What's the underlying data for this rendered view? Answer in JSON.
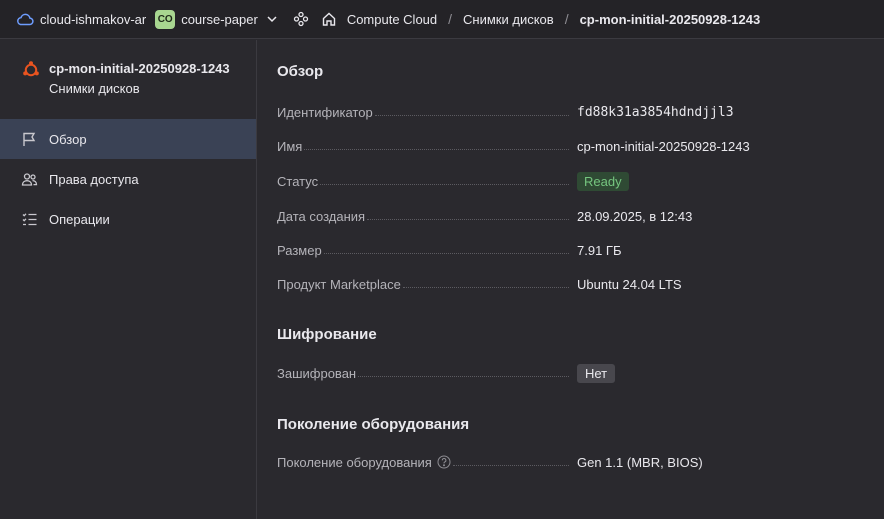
{
  "topbar": {
    "cloud_name": "cloud-ishmakov-ar",
    "folder_badge": "CO",
    "folder_name": "course-paper",
    "crumbs": [
      "Compute Cloud",
      "Снимки дисков",
      "cp-mon-initial-20250928-1243"
    ],
    "separator": "/"
  },
  "resource": {
    "title": "cp-mon-initial-20250928-1243",
    "subtitle": "Снимки дисков"
  },
  "nav": {
    "items": [
      {
        "label": "Обзор",
        "icon": "flag-icon",
        "active": true
      },
      {
        "label": "Права доступа",
        "icon": "users-icon",
        "active": false
      },
      {
        "label": "Операции",
        "icon": "list-icon",
        "active": false
      }
    ]
  },
  "overview": {
    "title": "Обзор",
    "rows": [
      {
        "label": "Идентификатор",
        "value": "fd88k31a3854hdndjjl3"
      },
      {
        "label": "Имя",
        "value": "cp-mon-initial-20250928-1243"
      },
      {
        "label": "Статус",
        "value": "Ready"
      },
      {
        "label": "Дата создания",
        "value": "28.09.2025, в 12:43"
      },
      {
        "label": "Размер",
        "value": "7.91 ГБ"
      },
      {
        "label": "Продукт Marketplace",
        "value": "Ubuntu 24.04 LTS"
      }
    ]
  },
  "encryption": {
    "title": "Шифрование",
    "rows": [
      {
        "label": "Зашифрован",
        "value": "Нет"
      }
    ]
  },
  "hardware": {
    "title": "Поколение оборудования",
    "rows": [
      {
        "label": "Поколение оборудования",
        "value": "Gen 1.1 (MBR, BIOS)"
      }
    ]
  },
  "colors": {
    "background": "#2a292e",
    "topbar": "#242327",
    "active_nav": "#3a4255",
    "status_ready": "#75c57f",
    "link": "#6e9dff",
    "ubuntu_orange": "#e95420"
  }
}
